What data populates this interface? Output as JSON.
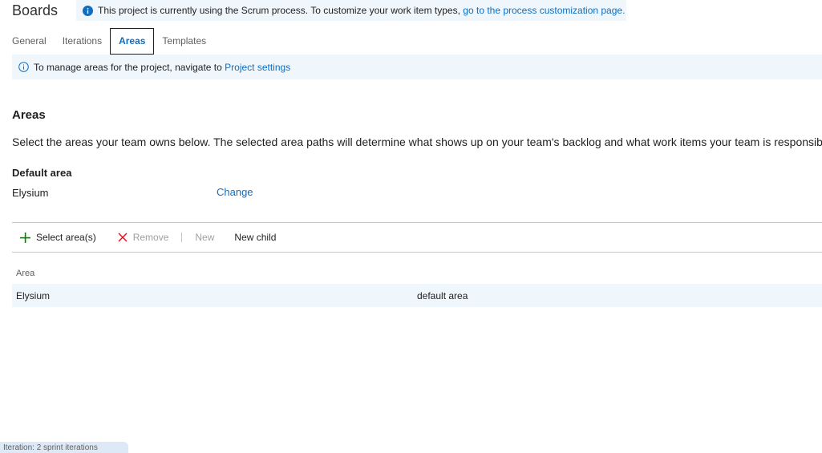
{
  "header": {
    "title": "Boards",
    "banner": {
      "text": "This project is currently using the Scrum process. To customize your work item types,",
      "link": "go to the process customization page."
    }
  },
  "tabs": [
    {
      "label": "General",
      "active": false
    },
    {
      "label": "Iterations",
      "active": false
    },
    {
      "label": "Areas",
      "active": true
    },
    {
      "label": "Templates",
      "active": false
    }
  ],
  "settings_bar": {
    "text": "To manage areas for the project, navigate to",
    "link": "Project settings"
  },
  "areas": {
    "title": "Areas",
    "description": "Select the areas your team owns below. The selected area paths will determine what shows up on your team's backlog and what work items your team is responsible for.",
    "default_area_label": "Default area",
    "default_area_value": "Elysium",
    "change_label": "Change"
  },
  "toolbar": {
    "select_areas": "Select area(s)",
    "remove": "Remove",
    "new": "New",
    "new_child": "New child"
  },
  "table": {
    "column_header": "Area",
    "rows": [
      {
        "area": "Elysium",
        "note": "default area"
      }
    ]
  },
  "status": {
    "text": "Iteration: 2 sprint iterations"
  },
  "colors": {
    "accent": "#106ebe",
    "banner_bg": "#eff6fc",
    "add_icon": "#107c10",
    "remove_icon": "#e81123"
  }
}
